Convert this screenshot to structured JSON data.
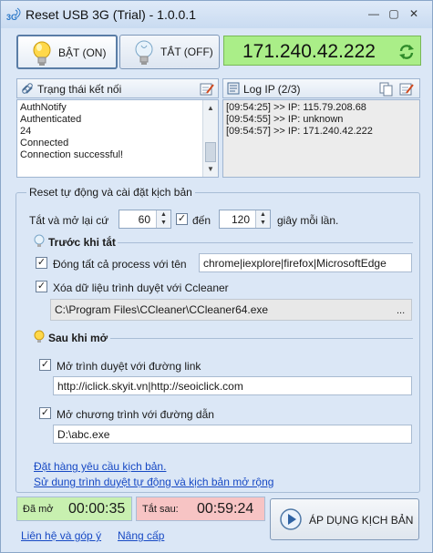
{
  "window": {
    "title": "Reset USB 3G (Trial) - 1.0.0.1",
    "logo": "3G",
    "min": "—",
    "restore": "▢",
    "close": "✕"
  },
  "toolbar": {
    "on_label": "BẬT (ON)",
    "off_label": "TẮT (OFF)",
    "ip": "171.240.42.222"
  },
  "status_panel": {
    "title": "Trạng thái kết nối",
    "lines": [
      "AuthNotify",
      "Authenticated",
      "24",
      "Connected",
      "Connection successful!"
    ]
  },
  "log_panel": {
    "title": "Log IP (2/3)",
    "lines": [
      "[09:54:25] >> IP: 115.79.208.68",
      "[09:54:55] >> IP: unknown",
      "[09:54:57] >> IP: 171.240.42.222"
    ]
  },
  "script": {
    "group_title": "Reset tự động và cài đặt kịch bản",
    "cycle_prefix": "Tắt và mở lại cứ",
    "from_value": "60",
    "to_label": "đến",
    "to_value": "120",
    "unit": "giây mỗi lần.",
    "before_title": "Trước khi tắt",
    "close_process_label": "Đóng tất cả process với tên",
    "process_names": "chrome|iexplore|firefox|MicrosoftEdge",
    "ccleaner_label": "Xóa dữ liệu trình duyệt với Ccleaner",
    "ccleaner_path": "C:\\Program Files\\CCleaner\\CCleaner64.exe",
    "browse": "...",
    "after_title": "Sau khi mở",
    "open_browser_label": "Mở trình duyệt với đường link",
    "browser_links": "http://iclick.skyit.vn|http://seoiclick.com",
    "open_program_label": "Mở chương trình với đường dẫn",
    "program_path": "D:\\abc.exe",
    "order_link": "Đặt hàng yêu cầu kịch bản.",
    "usage_link": "Sử dung trình duyệt tự động và kịch bản mở rộng"
  },
  "footer": {
    "opened_label": "Đã mở",
    "opened_time": "00:00:35",
    "off_after_label": "Tắt sau:",
    "off_after_time": "00:59:24",
    "apply_label": "ÁP DỤNG KỊCH BẢN",
    "contact_link": "Liên hệ và góp ý",
    "upgrade_link": "Nâng cấp"
  },
  "colors": {
    "ip_bg": "#aaee88",
    "opened_bg": "#c8f0b0",
    "off_bg": "#f7c4c4"
  }
}
